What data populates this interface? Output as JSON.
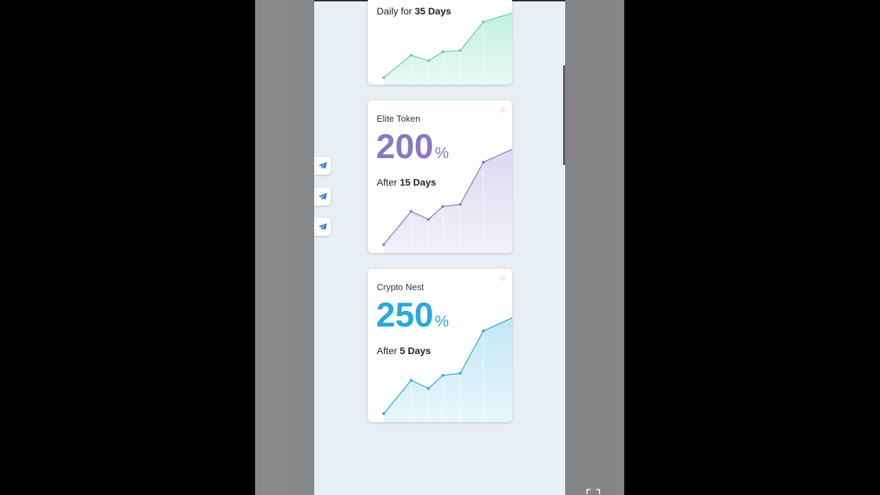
{
  "cards": [
    {
      "name": "",
      "sub_prefix": "Daily for ",
      "sub_value": "35 Days",
      "color": "#5fd1b0",
      "fill_top": "#bfeee0"
    },
    {
      "name": "Elite Token",
      "percent_value": "200",
      "percent_sign": "%",
      "sub_prefix": "After ",
      "sub_value": "15 Days",
      "color": "#8a78c4",
      "fill_top": "#dcd6f0"
    },
    {
      "name": "Crypto Nest",
      "percent_value": "250",
      "percent_sign": "%",
      "sub_prefix": "After ",
      "sub_value": "5 Days",
      "color": "#27a9de",
      "fill_top": "#bfe6f6"
    }
  ],
  "side_buttons": [
    {
      "icon": "telegram-icon",
      "color": "#2a6fd6"
    },
    {
      "icon": "telegram-icon",
      "color": "#2a6fd6"
    },
    {
      "icon": "telegram-icon",
      "color": "#2a6fd6"
    }
  ]
}
